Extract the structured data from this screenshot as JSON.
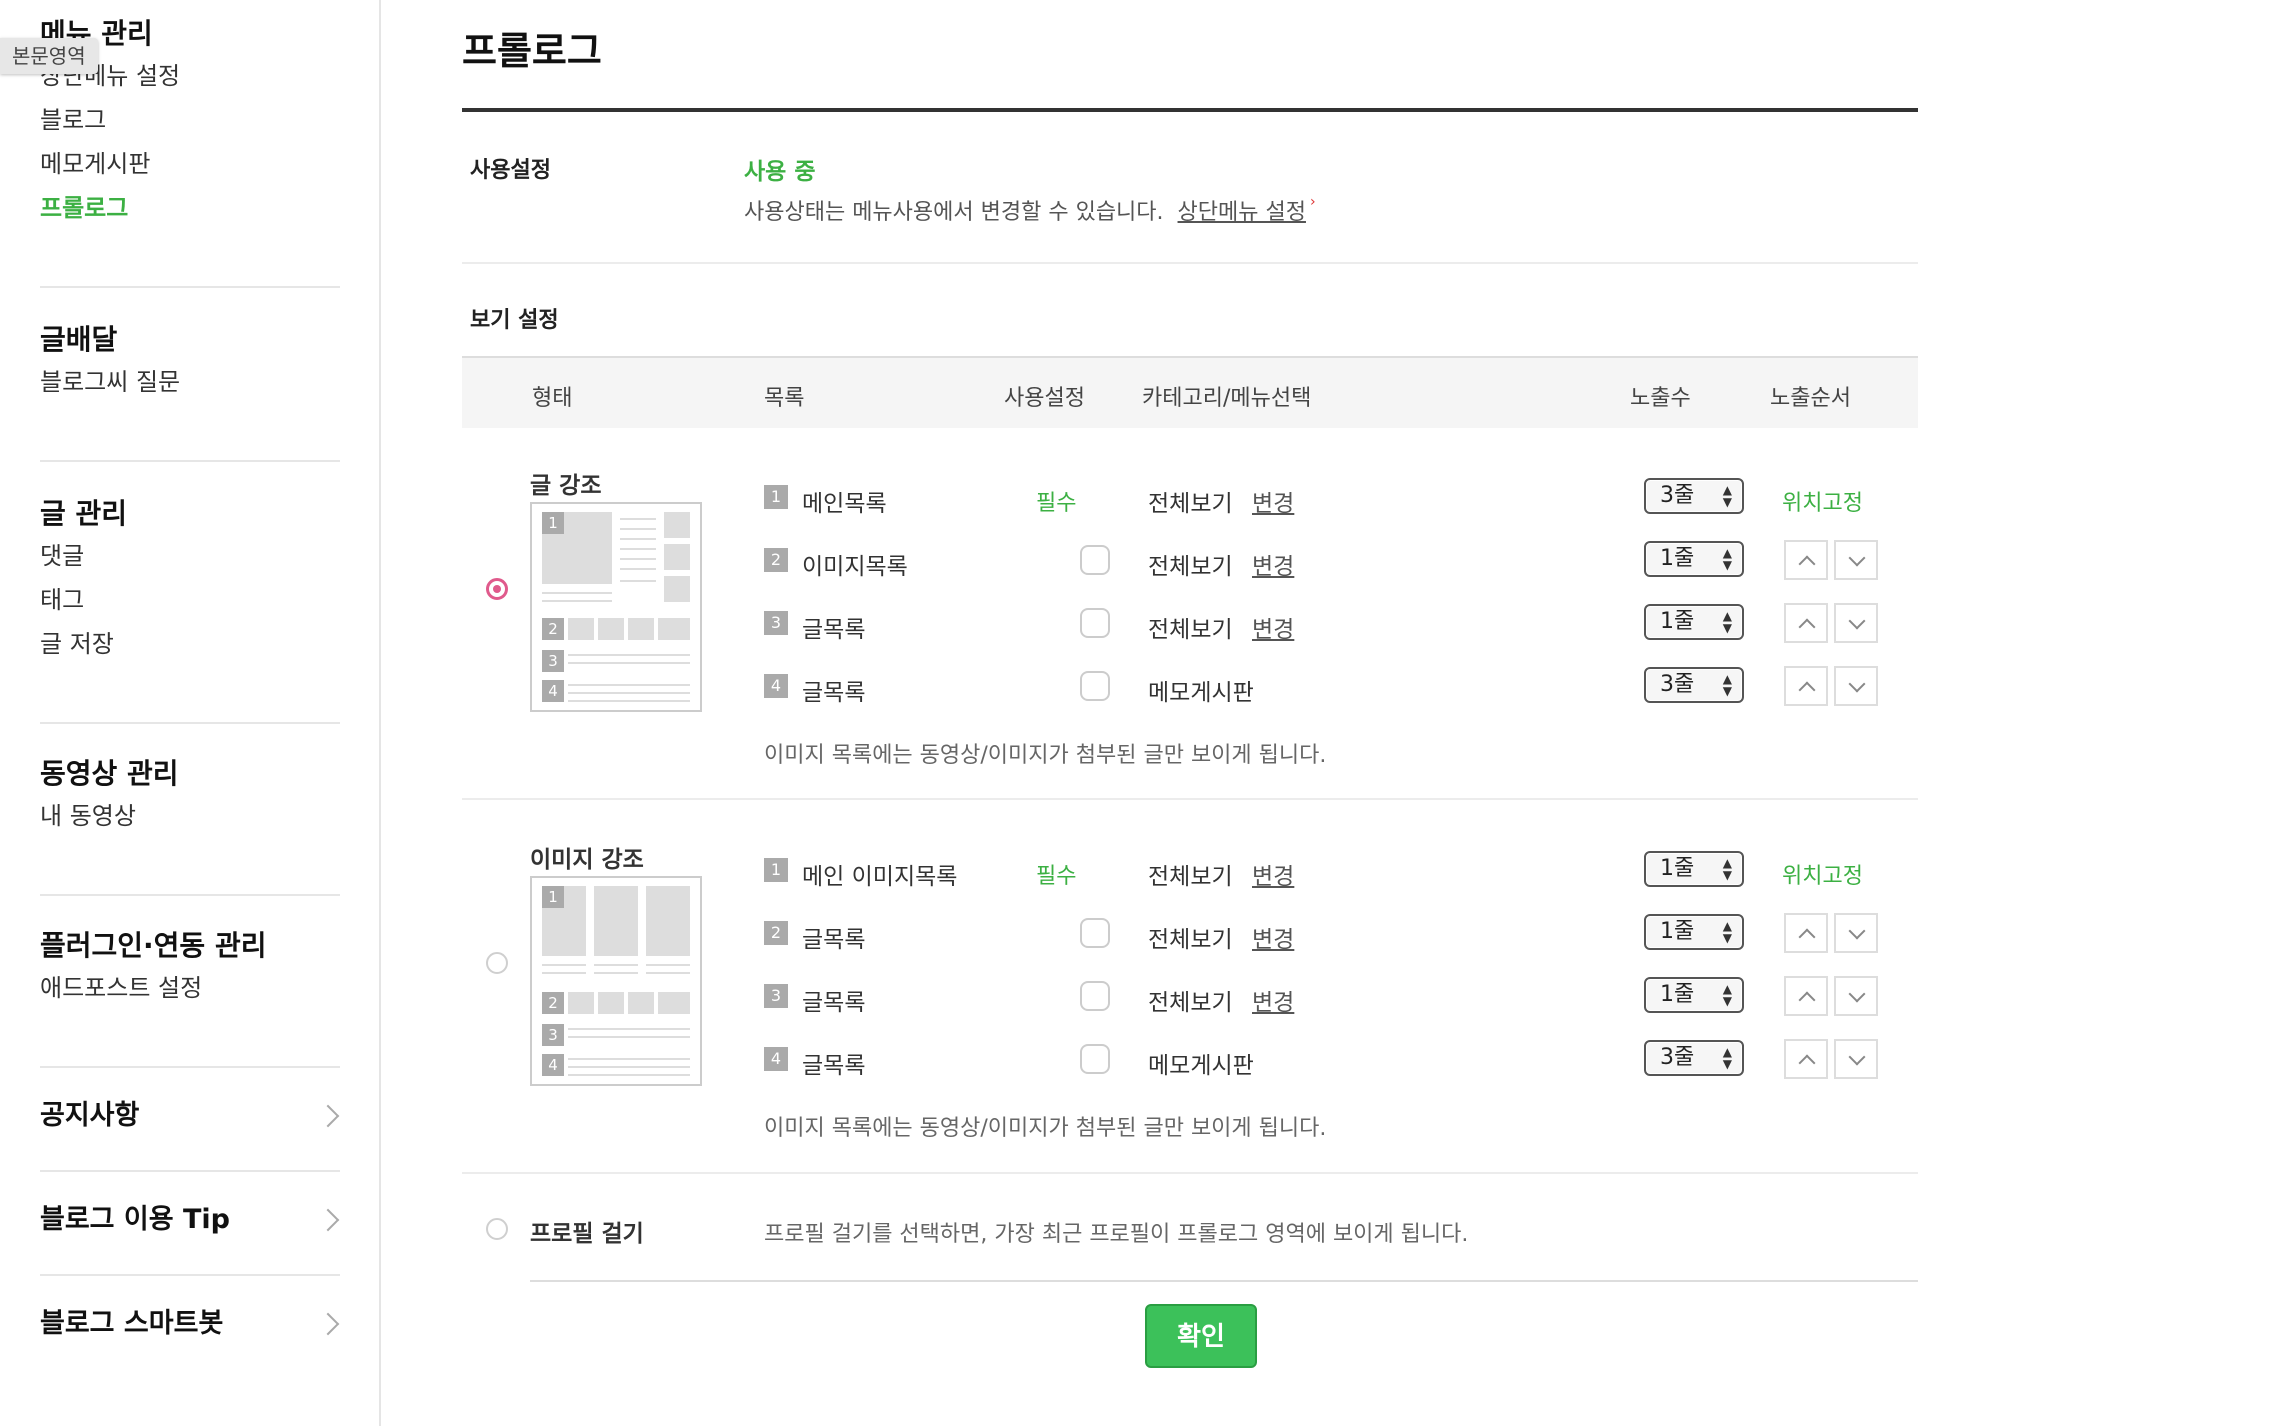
{
  "sidebar": {
    "body_tag": "본문영역",
    "groups": [
      {
        "title": "메뉴 관리",
        "items": [
          "상단메뉴 설정",
          "블로그",
          "메모게시판",
          "프롤로그"
        ]
      },
      {
        "title": "글배달",
        "items": [
          "블로그씨 질문"
        ]
      },
      {
        "title": "글 관리",
        "items": [
          "댓글",
          "태그",
          "글 저장"
        ]
      },
      {
        "title": "동영상 관리",
        "items": [
          "내 동영상"
        ]
      },
      {
        "title": "플러그인·연동 관리",
        "items": [
          "애드포스트 설정"
        ]
      }
    ],
    "links": [
      "공지사항",
      "블로그 이용 Tip",
      "블로그 스마트봇"
    ]
  },
  "main": {
    "title": "프롤로그",
    "usage": {
      "label": "사용설정",
      "status": "사용 중",
      "desc": "사용상태는 메뉴사용에서 변경할 수 있습니다.",
      "link": "상단메뉴 설정",
      "link_arrow": "›"
    },
    "view": {
      "label": "보기 설정",
      "headers": [
        "형태",
        "목록",
        "사용설정",
        "카테고리/메뉴선택",
        "노출수",
        "노출순서"
      ]
    },
    "options": [
      {
        "title": "글 강조",
        "checked": true,
        "rows": [
          {
            "num": "1",
            "name": "메인목록",
            "use": "필수",
            "category": "전체보기",
            "change": "변경",
            "count": "3줄",
            "order": "위치고정"
          },
          {
            "num": "2",
            "name": "이미지목록",
            "use": "",
            "category": "전체보기",
            "change": "변경",
            "count": "1줄",
            "order": ""
          },
          {
            "num": "3",
            "name": "글목록",
            "use": "",
            "category": "전체보기",
            "change": "변경",
            "count": "1줄",
            "order": ""
          },
          {
            "num": "4",
            "name": "글목록",
            "use": "",
            "category": "메모게시판",
            "change": "",
            "count": "3줄",
            "order": ""
          }
        ],
        "note": "이미지 목록에는 동영상/이미지가 첨부된 글만 보이게 됩니다."
      },
      {
        "title": "이미지 강조",
        "checked": false,
        "rows": [
          {
            "num": "1",
            "name": "메인 이미지목록",
            "use": "필수",
            "category": "전체보기",
            "change": "변경",
            "count": "1줄",
            "order": "위치고정"
          },
          {
            "num": "2",
            "name": "글목록",
            "use": "",
            "category": "전체보기",
            "change": "변경",
            "count": "1줄",
            "order": ""
          },
          {
            "num": "3",
            "name": "글목록",
            "use": "",
            "category": "전체보기",
            "change": "변경",
            "count": "1줄",
            "order": ""
          },
          {
            "num": "4",
            "name": "글목록",
            "use": "",
            "category": "메모게시판",
            "change": "",
            "count": "3줄",
            "order": ""
          }
        ],
        "note": "이미지 목록에는 동영상/이미지가 첨부된 글만 보이게 됩니다."
      }
    ],
    "profile": {
      "title": "프로필 걸기",
      "desc": "프로필 걸기를 선택하면, 가장 최근 프로필이 프롤로그 영역에 보이게 됩니다."
    },
    "confirm": "확인"
  },
  "colors": {
    "accent": "#3cb043",
    "radio_checked": "#e05a8c",
    "button": "#3cc15a"
  }
}
